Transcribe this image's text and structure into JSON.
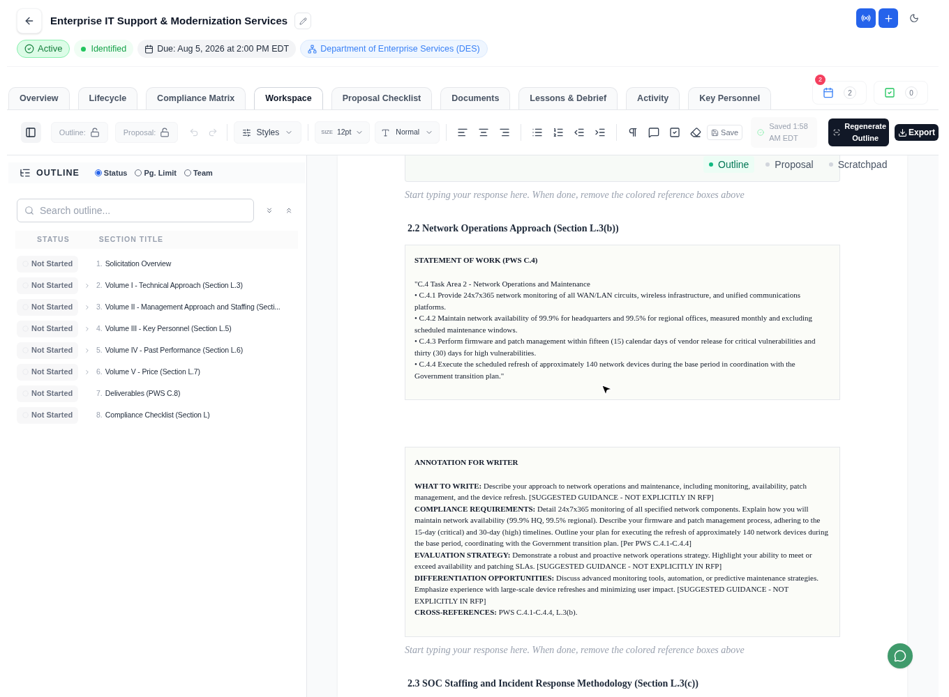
{
  "header": {
    "title": "Enterprise IT Support & Modernization Services",
    "badges": [
      {
        "kind": "status",
        "label": "Active"
      },
      {
        "kind": "stage",
        "label": "Identified"
      },
      {
        "kind": "due",
        "label": "Due: Aug 5, 2026 at 2:00 PM EDT"
      },
      {
        "kind": "agency",
        "label": "Department of Enterprise Services (DES)"
      }
    ]
  },
  "tabs": [
    {
      "label": "Overview",
      "selected": false
    },
    {
      "label": "Lifecycle",
      "selected": false
    },
    {
      "label": "Compliance Matrix",
      "selected": false
    },
    {
      "label": "Workspace",
      "selected": true
    },
    {
      "label": "Proposal Checklist",
      "selected": false
    },
    {
      "label": "Documents",
      "selected": false
    },
    {
      "label": "Lessons & Debrief",
      "selected": false
    },
    {
      "label": "Activity",
      "selected": false
    },
    {
      "label": "Key Personnel",
      "selected": false
    }
  ],
  "counters": [
    {
      "kind": "calendar",
      "count": "2",
      "alert": "2"
    },
    {
      "kind": "tasks",
      "count": "0"
    }
  ],
  "toolbar": {
    "outline_lock": {
      "label": "Outline:",
      "locked": false
    },
    "proposal_lock": {
      "label": "Proposal:",
      "locked": false
    },
    "undo": {
      "disabled": true
    },
    "redo": {
      "disabled": true
    },
    "styles": "Styles",
    "size": {
      "label": "SIZE",
      "value": "12pt"
    },
    "block_style": "Normal",
    "save": {
      "label": "Save",
      "disabled": true
    },
    "saved_status": "Saved 1:58 AM EDT",
    "regenerate": "Regenerate Outline",
    "export": "Export"
  },
  "outline": {
    "title": "OUTLINE",
    "views": [
      {
        "label": "Status",
        "selected": true
      },
      {
        "label": "Pg. Limit",
        "selected": false
      },
      {
        "label": "Team",
        "selected": false
      }
    ],
    "search": {
      "placeholder": "Search outline..."
    },
    "columns": [
      "STATUS",
      "SECTION TITLE"
    ],
    "rows": [
      {
        "status": "Not Started",
        "number": "1.",
        "title": "Solicitation Overview",
        "expandable": false
      },
      {
        "status": "Not Started",
        "number": "2.",
        "title": "Volume I - Technical Approach (Section L.3)",
        "expandable": true
      },
      {
        "status": "Not Started",
        "number": "3.",
        "title": "Volume II - Management Approach and Staffing (Secti...",
        "expandable": true
      },
      {
        "status": "Not Started",
        "number": "4.",
        "title": "Volume III - Key Personnel (Section L.5)",
        "expandable": true
      },
      {
        "status": "Not Started",
        "number": "5.",
        "title": "Volume IV - Past Performance (Section L.6)",
        "expandable": true
      },
      {
        "status": "Not Started",
        "number": "6.",
        "title": "Volume V - Price (Section L.7)",
        "expandable": true
      },
      {
        "status": "Not Started",
        "number": "7.",
        "title": "Deliverables (PWS C.8)",
        "expandable": false
      },
      {
        "status": "Not Started",
        "number": "8.",
        "title": "Compliance Checklist (Section L)",
        "expandable": false
      }
    ]
  },
  "editor": {
    "modes": [
      {
        "label": "Outline",
        "selected": true
      },
      {
        "label": "Proposal",
        "selected": false
      },
      {
        "label": "Scratchpad",
        "selected": false
      }
    ],
    "blocks": [
      {
        "kind": "reference_end"
      },
      {
        "kind": "placeholder",
        "text": "Start typing your response here. When done, remove the colored reference boxes above"
      },
      {
        "kind": "heading",
        "text": "2.2 Network Operations Approach (Section L.3(b))"
      },
      {
        "kind": "reference",
        "title": "STATEMENT OF WORK (PWS C.4)",
        "lines": [
          "\"C.4 Task Area 2 - Network Operations and Maintenance",
          "• C.4.1 Provide 24x7x365 network monitoring of all WAN/LAN circuits, wireless infrastructure, and unified communications platforms.",
          "• C.4.2 Maintain network availability of 99.9% for headquarters and 99.5% for regional offices, measured monthly and excluding scheduled maintenance windows.",
          "• C.4.3 Perform firmware and patch management within fifteen (15) calendar days of vendor release for critical vulnerabilities and thirty (30) days for high vulnerabilities.",
          "• C.4.4 Execute the scheduled refresh of approximately 140 network devices during the base period in coordination with the Government transition plan.\""
        ]
      },
      {
        "kind": "reference",
        "title": "ANNOTATION FOR WRITER",
        "lines": [
          "**WHAT TO WRITE:** Describe your approach to network operations and maintenance, including monitoring, availability, patch management, and the device refresh. [SUGGESTED GUIDANCE - NOT EXPLICITLY IN RFP]",
          "**COMPLIANCE REQUIREMENTS:** Detail 24x7x365 monitoring of all specified network components. Explain how you will maintain network availability (99.9% HQ, 99.5% regional). Describe your firmware and patch management process, adhering to the 15-day (critical) and 30-day (high) timelines. Outline your plan for executing the refresh of approximately 140 network devices during the base period, coordinating with the Government transition plan. [Per PWS C.4.1-C.4.4]",
          "**EVALUATION STRATEGY:** Demonstrate a robust and proactive network operations strategy. Highlight your ability to meet or exceed availability and patching SLAs. [SUGGESTED GUIDANCE - NOT EXPLICITLY IN RFP]",
          "**DIFFERENTIATION OPPORTUNITIES:** Discuss advanced monitoring tools, automation, or predictive maintenance strategies. Emphasize experience with large-scale device refreshes and minimizing user impact. [SUGGESTED GUIDANCE - NOT EXPLICITLY IN RFP]",
          "**CROSS-REFERENCES:** PWS C.4.1-C.4.4, L.3(b)."
        ]
      },
      {
        "kind": "placeholder",
        "text": "Start typing your response here. When done, remove the colored reference boxes above"
      },
      {
        "kind": "heading",
        "text": "2.3 SOC Staffing and Incident Response Methodology (Section L.3(c))"
      }
    ]
  }
}
